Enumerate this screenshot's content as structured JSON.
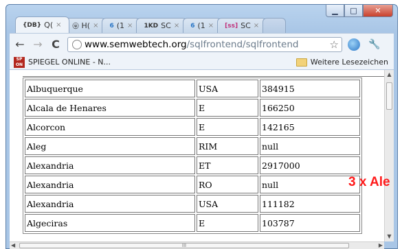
{
  "window": {
    "buttons": {
      "minimize": "▁",
      "maximize": "□",
      "close": "✕"
    }
  },
  "tabs": [
    {
      "favicon": "{DB}",
      "label": "Q(",
      "active": true
    },
    {
      "favicon": "ⓤ",
      "label": "H(",
      "active": false
    },
    {
      "favicon": "6",
      "label": "(1",
      "active": false
    },
    {
      "favicon": "1KD",
      "label": "SC",
      "active": false
    },
    {
      "favicon": "6",
      "label": "(1",
      "active": false
    },
    {
      "favicon": "[ss]",
      "label": "SC",
      "active": false
    }
  ],
  "toolbar": {
    "back_icon": "←",
    "forward_icon": "→",
    "reload_icon": "C",
    "url_domain": "www.semwebtech.org",
    "url_path": "/sqlfrontend/sqlfrontend",
    "star_icon": "☆",
    "wrench_icon": "🔧"
  },
  "bookmarks": {
    "left_label": "SPIEGEL ONLINE - N...",
    "left_icon_text": "SP ON",
    "right_label": "Weitere Lesezeichen"
  },
  "table": {
    "rows": [
      [
        "Albuquerque",
        "USA",
        "384915"
      ],
      [
        "Alcala de Henares",
        "E",
        "166250"
      ],
      [
        "Alcorcon",
        "E",
        "142165"
      ],
      [
        "Aleg",
        "RIM",
        "null"
      ],
      [
        "Alexandria",
        "ET",
        "2917000"
      ],
      [
        "Alexandria",
        "RO",
        "null"
      ],
      [
        "Alexandria",
        "USA",
        "111182"
      ],
      [
        "Algeciras",
        "E",
        "103787"
      ]
    ]
  },
  "scrollbar": {
    "h_thumb_grip": "III"
  },
  "annotation": {
    "text": "3 x Ale",
    "color": "#ff1a1a"
  }
}
